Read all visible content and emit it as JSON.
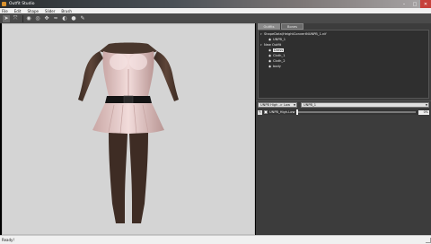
{
  "window": {
    "title": "Outfit Studio"
  },
  "menu": [
    "File",
    "Edit",
    "Shape",
    "Slider",
    "Brush"
  ],
  "toolbar": [
    "select-tool-icon",
    "move-tool-icon",
    "inflate-brush-icon",
    "deflate-brush-icon",
    "move-brush-icon",
    "smooth-brush-icon",
    "weight-brush-icon",
    "color-brush-icon",
    "pin-icon"
  ],
  "tabs": {
    "outfit": "Outfits",
    "bones": "Bones"
  },
  "tree": {
    "reference_label": "ShapeData\\HeightConvertNUNPB_1.nif",
    "reference_child": "UNPB_1",
    "outfit_label": "New Outfit",
    "items": [
      "Dress",
      "Cloth_1",
      "Cloth_2",
      "body"
    ]
  },
  "combos": {
    "left": "UNPB High -> Low",
    "right": "UNPB_1"
  },
  "slider": {
    "name": "UNPB_High-Low",
    "value": "0%",
    "level": 0
  },
  "status": "Ready!"
}
